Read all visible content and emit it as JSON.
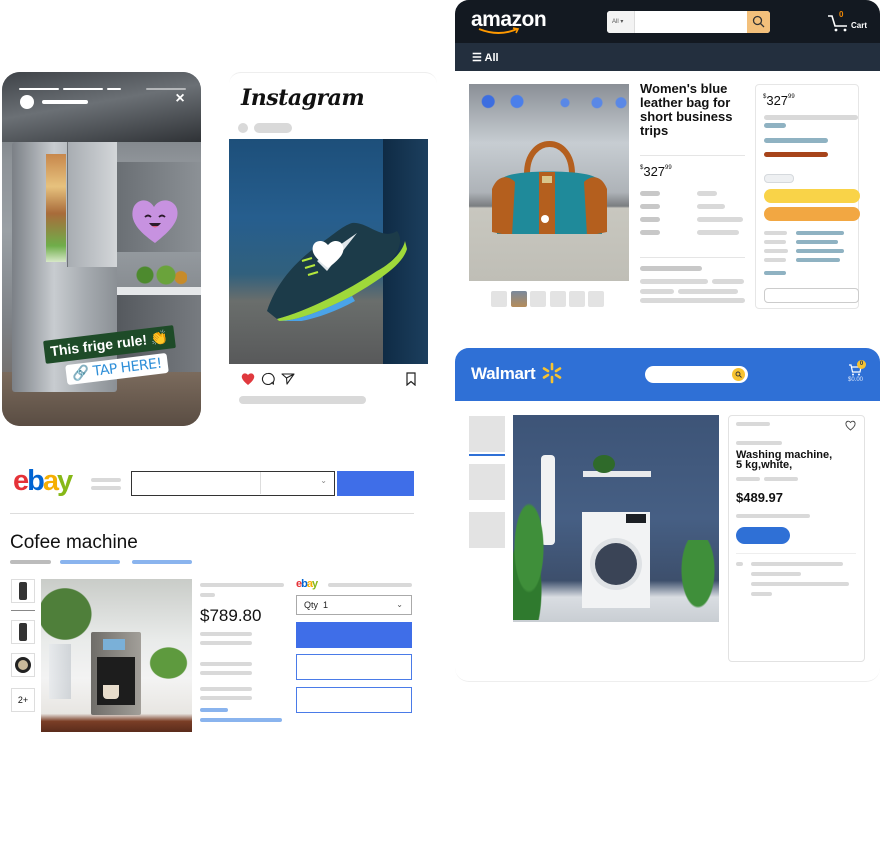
{
  "story": {
    "platform": "Instagram Story",
    "close_icon": "×",
    "sticker_text": "This frige rule! 👏",
    "link_sticker": "🔗 TAP HERE!",
    "emoji_sticker": "smiling-heart"
  },
  "instagram_post": {
    "logo": "Instagram",
    "actions": [
      "like-icon",
      "comment-icon",
      "share-icon",
      "bookmark-icon"
    ],
    "liked": true
  },
  "amazon": {
    "logo": "amazon",
    "search": {
      "category": "All",
      "placeholder": ""
    },
    "cart": {
      "count": "0",
      "label": "Cart"
    },
    "nav": {
      "menu_label": "All"
    },
    "product": {
      "title": "Women's blue leather bag for short business trips",
      "price_symbol": "$",
      "price_whole": "327",
      "price_fraction": "99"
    },
    "buybox": {
      "price_symbol": "$",
      "price_whole": "327",
      "price_fraction": "99"
    },
    "colors": {
      "header": "#131921",
      "nav": "#232f3e",
      "add_to_cart": "#f9d348",
      "buy_now": "#f2a742",
      "search_button": "#f3c07b"
    }
  },
  "walmart": {
    "logo": "Walmart",
    "cart": {
      "count": "0",
      "total": "$0.00"
    },
    "product": {
      "title_line1": "Washing machine,",
      "title_line2": "5 kg,white,",
      "price": "$489.97"
    },
    "colors": {
      "header": "#2f70d6",
      "spark": "#f7c331"
    }
  },
  "ebay": {
    "logo": {
      "e": "e",
      "b": "b",
      "a": "a",
      "y": "y"
    },
    "product": {
      "title": "Cofee machine",
      "price": "$789.80",
      "qty_label": "Qty",
      "qty_value": "1",
      "more_thumbs": "2+"
    },
    "colors": {
      "primary": "#3f6ee8"
    }
  }
}
